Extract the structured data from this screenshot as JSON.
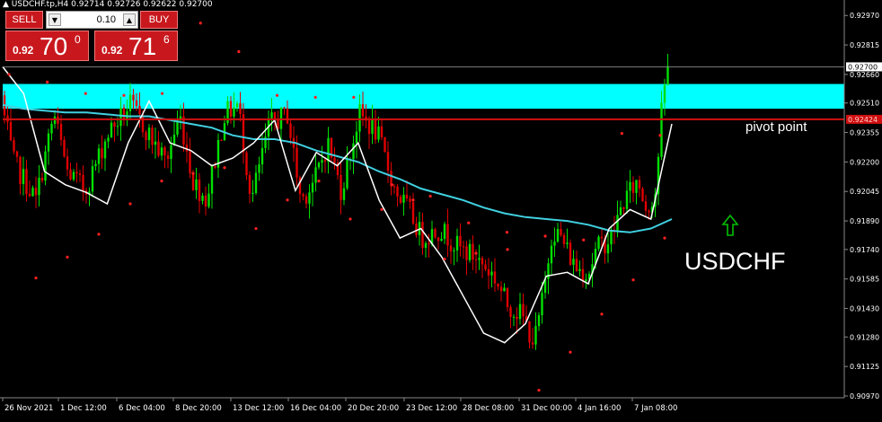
{
  "window": {
    "title": "USDCHF.tp,H4",
    "ohlc": "0.92714 0.92726 0.92622 0.92700"
  },
  "trade_panel": {
    "sell_label": "SELL",
    "buy_label": "BUY",
    "lot": "0.10",
    "bid_prefix": "0.92",
    "bid_big": "70",
    "bid_sup": "0",
    "ask_prefix": "0.92",
    "ask_big": "71",
    "ask_sup": "6"
  },
  "annotations": {
    "pivot_label": "pivot point",
    "symbol_label": "USDCHF"
  },
  "colors": {
    "background": "#000000",
    "bull": "#00e000",
    "bear": "#e00000",
    "zone": "#00ffff",
    "pivot_line": "#d01010",
    "ma_fast": "#ffffff",
    "ma_slow": "#40d0e0",
    "psar": "#ff2020",
    "arrow": "#00c000"
  },
  "chart_data": {
    "type": "candlestick",
    "symbol": "USDCHF.tp",
    "timeframe": "H4",
    "ylim": [
      0.9097,
      0.9299
    ],
    "y_ticks": [
      "0.92970",
      "0.92815",
      "0.92660",
      "0.92510",
      "0.92355",
      "0.92200",
      "0.92045",
      "0.91890",
      "0.91740",
      "0.91585",
      "0.91430",
      "0.91280",
      "0.91125",
      "0.90970"
    ],
    "x_ticks": [
      "26 Nov 2021",
      "1 Dec 12:00",
      "6 Dec 04:00",
      "8 Dec 20:00",
      "13 Dec 12:00",
      "16 Dec 04:00",
      "20 Dec 20:00",
      "23 Dec 12:00",
      "28 Dec 08:00",
      "31 Dec 00:00",
      "4 Jan 16:00",
      "7 Jan 08:00"
    ],
    "current_price": "0.92700",
    "pivot_price": "0.92424",
    "supply_zone": [
      0.9248,
      0.9261
    ],
    "ma_fast": [
      0.927,
      0.9256,
      0.9215,
      0.9208,
      0.9204,
      0.9198,
      0.923,
      0.9252,
      0.923,
      0.9226,
      0.9218,
      0.9222,
      0.923,
      0.9242,
      0.9205,
      0.9225,
      0.9218,
      0.923,
      0.92,
      0.918,
      0.9185,
      0.917,
      0.915,
      0.913,
      0.9125,
      0.9135,
      0.916,
      0.9162,
      0.9156,
      0.9185,
      0.9195,
      0.919,
      0.924
    ],
    "ma_slow": [
      0.925,
      0.9248,
      0.9247,
      0.9246,
      0.9246,
      0.9245,
      0.9244,
      0.9244,
      0.9242,
      0.924,
      0.9238,
      0.9234,
      0.9232,
      0.9232,
      0.923,
      0.9226,
      0.9223,
      0.922,
      0.9215,
      0.9211,
      0.9206,
      0.9203,
      0.92,
      0.9196,
      0.9193,
      0.9191,
      0.919,
      0.9189,
      0.9187,
      0.9184,
      0.9183,
      0.9185,
      0.919
    ],
    "psar_low": [
      0.9159,
      0.917,
      0.9182,
      0.9198,
      0.921,
      0.9214,
      0.9217,
      0.9185,
      0.92,
      0.921,
      0.919,
      0.9195,
      0.92,
      0.9169,
      0.9172,
      0.9174,
      0.91,
      0.912,
      0.914,
      0.9158,
      0.918
    ],
    "psar_high": [
      0.9266,
      0.9262,
      0.9256,
      0.9255,
      0.9256,
      0.9293,
      0.9278,
      0.9255,
      0.9254,
      0.9254,
      0.9208,
      0.9202,
      0.9188,
      0.9183,
      0.9181,
      0.9179,
      0.9235,
      0.9234
    ]
  }
}
